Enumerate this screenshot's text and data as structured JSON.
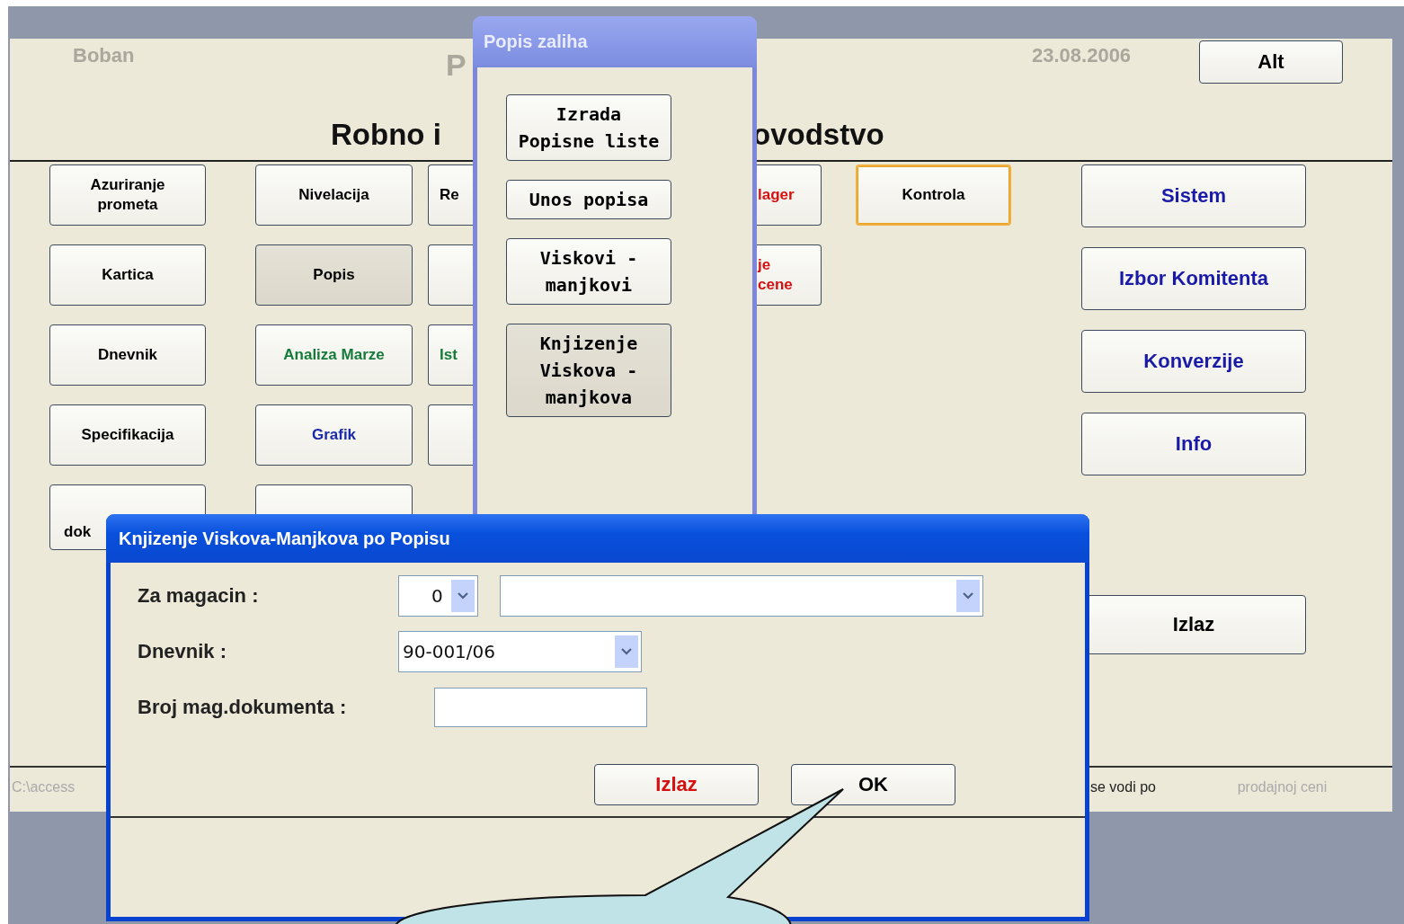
{
  "main_form": {
    "user": "Boban",
    "title": "P",
    "date": "23.08.2006",
    "alt_button": "Alt",
    "heading": [
      "Robno i",
      "ovodstvo"
    ],
    "button_columns": [
      {
        "kind": "full",
        "buttons": [
          {
            "kind": "normal",
            "label": "Azuriranje\nprometa",
            "color": "#000000",
            "pressed": false,
            "focused": false
          },
          {
            "kind": "normal",
            "label": "Kartica",
            "color": "#000000",
            "pressed": false,
            "focused": false
          },
          {
            "kind": "normal",
            "label": "Dnevnik",
            "color": "#000000",
            "pressed": false,
            "focused": false
          },
          {
            "kind": "normal",
            "label": "Specifikacija",
            "color": "#000000",
            "pressed": false,
            "focused": false
          },
          {
            "kind": "partial",
            "label": "dok",
            "color": "#000000",
            "pressed": false,
            "focused": false
          }
        ]
      },
      {
        "kind": "full",
        "buttons": [
          {
            "kind": "normal",
            "label": "Nivelacija",
            "color": "#000000",
            "pressed": false,
            "focused": false
          },
          {
            "kind": "normal",
            "label": "Popis",
            "color": "#000000",
            "pressed": true,
            "focused": false
          },
          {
            "kind": "normal",
            "label": "Analiza Marze",
            "color": "#157a3a",
            "pressed": false,
            "focused": false
          },
          {
            "kind": "normal",
            "label": "Grafik",
            "color": "#1a2aa8",
            "pressed": false,
            "focused": false
          },
          {
            "kind": "partial",
            "pressed": false,
            "focused": false
          }
        ]
      },
      {
        "kind": "left-part",
        "buttons": [
          {
            "label": "Re",
            "color": "#000000",
            "pressed": false,
            "focused": false
          },
          {
            "pressed": false,
            "focused": false
          },
          {
            "label": "Ist",
            "color": "#157a3a",
            "pressed": false,
            "focused": false
          },
          {
            "pressed": false,
            "focused": false
          }
        ]
      },
      {
        "kind": "right-part",
        "buttons": [
          {
            "label": "lager",
            "color": "#d41010",
            "pressed": false,
            "focused": false
          },
          {
            "label": "je\ncene",
            "color": "#d41010",
            "pressed": false,
            "focused": false
          }
        ]
      },
      {
        "kind": "full",
        "buttons": [
          {
            "kind": "normal",
            "label": "Kontrola",
            "color": "#000000",
            "pressed": false,
            "focused": true
          }
        ]
      },
      {
        "kind": "wide",
        "buttons": [
          {
            "kind": "normal",
            "label": "Sistem",
            "color": "#1a1aa8",
            "pressed": false,
            "focused": false
          },
          {
            "kind": "normal",
            "label": "Izbor Komitenta",
            "color": "#1a1aa8",
            "pressed": false,
            "focused": false
          },
          {
            "kind": "normal",
            "label": "Konverzije",
            "color": "#1a1aa8",
            "pressed": false,
            "focused": false
          },
          {
            "kind": "normal",
            "label": "Info",
            "color": "#1a1aa8",
            "pressed": false,
            "focused": false
          },
          {
            "kind": "exit",
            "label": "Izlaz",
            "color": "#000000",
            "pressed": false,
            "focused": false
          }
        ]
      }
    ],
    "status_bar": {
      "path": "C:\\access",
      "note": "se vodi po",
      "value": "prodajnoj ceni"
    }
  },
  "popup": {
    "title": "Popis zaliha",
    "buttons": [
      {
        "label": "Izrada\nPopisne liste",
        "pressed": false
      },
      {
        "label": "Unos popisa",
        "pressed": false
      },
      {
        "label": "Viskovi -\nmanjkovi",
        "pressed": false
      },
      {
        "label": "Knjizenje\nViskova -\nmanjkova",
        "pressed": true
      }
    ]
  },
  "dialog": {
    "title": "Knjizenje Viskova-Manjkova po Popisu",
    "fields": [
      {
        "kind": "double-combo",
        "label": "Za magacin :",
        "value": "0"
      },
      {
        "kind": "combo",
        "label": "Dnevnik :",
        "value": "90-001/06"
      },
      {
        "kind": "text",
        "label": "Broj mag.dokumenta :"
      }
    ],
    "buttons": [
      {
        "label": "Izlaz",
        "color": "#d41010"
      },
      {
        "label": "OK",
        "color": "#000000"
      }
    ]
  }
}
